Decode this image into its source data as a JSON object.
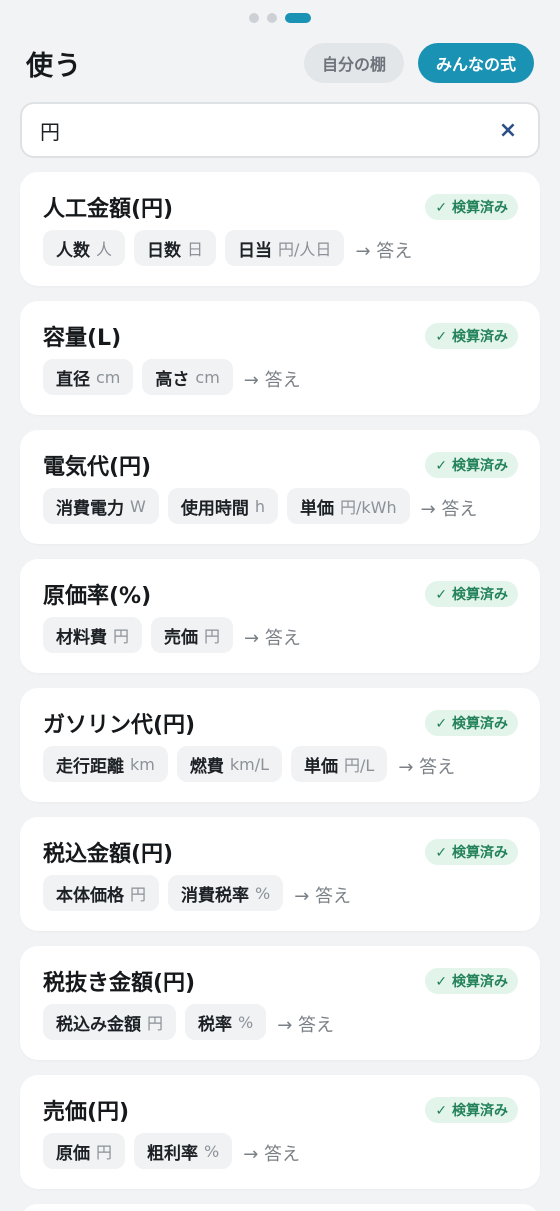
{
  "header": {
    "title": "使う",
    "shelf_button": "自分の棚",
    "community_button": "みんなの式"
  },
  "search": {
    "value": "円",
    "clear_icon": "×"
  },
  "badge_text": "✓ 検算済み",
  "answer_text": "→ 答え",
  "formulas": [
    {
      "title": "人工金額(円)",
      "inputs": [
        {
          "label": "人数",
          "unit": "人"
        },
        {
          "label": "日数",
          "unit": "日"
        },
        {
          "label": "日当",
          "unit": "円/人日"
        }
      ]
    },
    {
      "title": "容量(L)",
      "inputs": [
        {
          "label": "直径",
          "unit": "cm"
        },
        {
          "label": "高さ",
          "unit": "cm"
        }
      ]
    },
    {
      "title": "電気代(円)",
      "inputs": [
        {
          "label": "消費電力",
          "unit": "W"
        },
        {
          "label": "使用時間",
          "unit": "h"
        },
        {
          "label": "単価",
          "unit": "円/kWh"
        }
      ]
    },
    {
      "title": "原価率(%)",
      "inputs": [
        {
          "label": "材料費",
          "unit": "円"
        },
        {
          "label": "売価",
          "unit": "円"
        }
      ]
    },
    {
      "title": "ガソリン代(円)",
      "inputs": [
        {
          "label": "走行距離",
          "unit": "km"
        },
        {
          "label": "燃費",
          "unit": "km/L"
        },
        {
          "label": "単価",
          "unit": "円/L"
        }
      ]
    },
    {
      "title": "税込金額(円)",
      "inputs": [
        {
          "label": "本体価格",
          "unit": "円"
        },
        {
          "label": "消費税率",
          "unit": "%"
        }
      ]
    },
    {
      "title": "税抜き金額(円)",
      "inputs": [
        {
          "label": "税込み金額",
          "unit": "円"
        },
        {
          "label": "税率",
          "unit": "%"
        }
      ]
    },
    {
      "title": "売価(円)",
      "inputs": [
        {
          "label": "原価",
          "unit": "円"
        },
        {
          "label": "粗利率",
          "unit": "%"
        }
      ]
    }
  ],
  "pagination": {
    "pages": 3,
    "active": 3
  },
  "colors": {
    "accent": "#1a92b3",
    "badge_bg": "#e3f4ea",
    "badge_fg": "#23825a",
    "clear_icon": "#2b4f86"
  }
}
